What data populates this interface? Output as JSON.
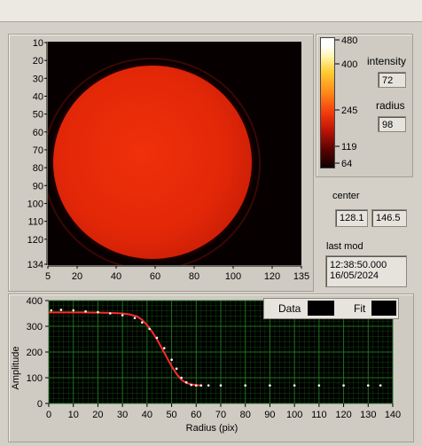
{
  "image_view": {
    "y_ticks": [
      "10",
      "20",
      "30",
      "40",
      "50",
      "60",
      "70",
      "80",
      "90",
      "100",
      "110",
      "120",
      "134"
    ],
    "x_ticks": [
      "5",
      "20",
      "40",
      "60",
      "80",
      "100",
      "120",
      "135"
    ]
  },
  "colorbar": {
    "ticks": [
      "480",
      "400",
      "245",
      "119",
      "64"
    ]
  },
  "intensity": {
    "label": "intensity",
    "value": "72"
  },
  "radius": {
    "label": "radius",
    "value": "98"
  },
  "center": {
    "label": "center",
    "x": "128.1",
    "y": "146.5"
  },
  "last_mod": {
    "label": "last mod",
    "time": "12:38:50.000",
    "date": "16/05/2024"
  },
  "legend": {
    "data_label": "Data",
    "fit_label": "Fit"
  },
  "colors": {
    "plot_bg": "#000000",
    "grid": "#1f7a1f",
    "data": "#ffffff",
    "fit": "#ff2a2a",
    "disk": "#e82608"
  },
  "chart_data": {
    "type": "scatter",
    "xlabel": "Radius (pix)",
    "ylabel": "Amplitude",
    "xlim": [
      0,
      140
    ],
    "ylim": [
      0,
      400
    ],
    "x_ticks": [
      "0",
      "10",
      "20",
      "30",
      "40",
      "50",
      "60",
      "70",
      "80",
      "90",
      "100",
      "110",
      "120",
      "130",
      "140"
    ],
    "y_ticks": [
      "0",
      "100",
      "200",
      "300",
      "400"
    ],
    "grid": true,
    "legend_position": "top-right",
    "series": [
      {
        "name": "Data",
        "x": [
          1,
          5,
          10,
          15,
          20,
          25,
          30,
          35,
          38,
          41,
          44,
          47,
          50,
          52,
          54,
          56,
          58,
          60,
          62,
          65,
          70,
          80,
          90,
          100,
          110,
          120,
          130,
          135
        ],
        "y": [
          362,
          364,
          362,
          358,
          355,
          350,
          343,
          332,
          315,
          290,
          255,
          215,
          170,
          135,
          100,
          82,
          72,
          70,
          70,
          70,
          70,
          70,
          70,
          70,
          70,
          70,
          70,
          70
        ]
      },
      {
        "name": "Fit",
        "x": [
          0,
          5,
          10,
          15,
          20,
          25,
          30,
          33,
          36,
          38,
          40,
          42,
          44,
          46,
          48,
          50,
          52,
          54,
          56,
          58,
          60,
          62
        ],
        "y": [
          354,
          354,
          354,
          354,
          353,
          352,
          350,
          346,
          338,
          325,
          305,
          280,
          250,
          215,
          180,
          145,
          115,
          92,
          80,
          74,
          71,
          70
        ]
      }
    ]
  }
}
